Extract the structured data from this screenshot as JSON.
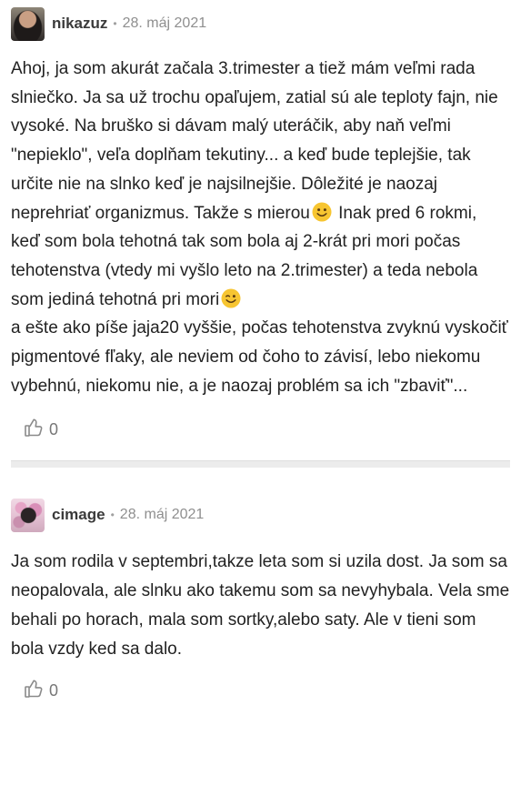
{
  "comments": [
    {
      "author": "nikazuz",
      "date": "28. máj 2021",
      "body": [
        "Ahoj, ja som akurát začala 3.trimester a tiež mám veľmi rada slniečko. Ja sa už trochu opaľujem, zatial sú ale teploty fajn, nie vysoké. Na bruško si dávam malý uteráčik, aby naň veľmi \"nepieklo\", veľa doplňam tekutiny... a keď bude teplejšie, tak určite nie na slnko keď je najsilnejšie. Dôležité je naozaj neprehriať organizmus. Takže s mierou",
        " Inak pred 6 rokmi, keď som bola tehotná tak som bola aj 2-krát pri mori počas tehotenstva (vtedy mi vyšlo leto na 2.trimester) a teda nebola som jediná tehotná pri mori",
        "a ešte ako píše jaja20 vyššie, počas tehotenstva zvyknú vyskočiť pigmentové fľaky, ale neviem od čoho to závisí, lebo niekomu vybehnú, niekomu nie, a je naozaj problém sa ich \"zbaviť\"..."
      ],
      "emojis": [
        "slightly-smiling-face-icon",
        "winking-face-icon"
      ],
      "likes": "0"
    },
    {
      "author": "cimage",
      "date": "28. máj 2021",
      "body": [
        "Ja som rodila v septembri,takze leta som si uzila dost. Ja som sa neopalovala, ale slnku ako takemu som sa nevyhybala. Vela sme behali po horach, mala som sortky,alebo saty. Ale v tieni som bola vzdy ked sa dalo."
      ],
      "likes": "0"
    }
  ],
  "meta_separator": "•",
  "colors": {
    "text": "#222222",
    "author": "#3a3a3a",
    "muted": "#8f8f8f",
    "separator": "#ececec",
    "emoji": "#f7c531"
  }
}
